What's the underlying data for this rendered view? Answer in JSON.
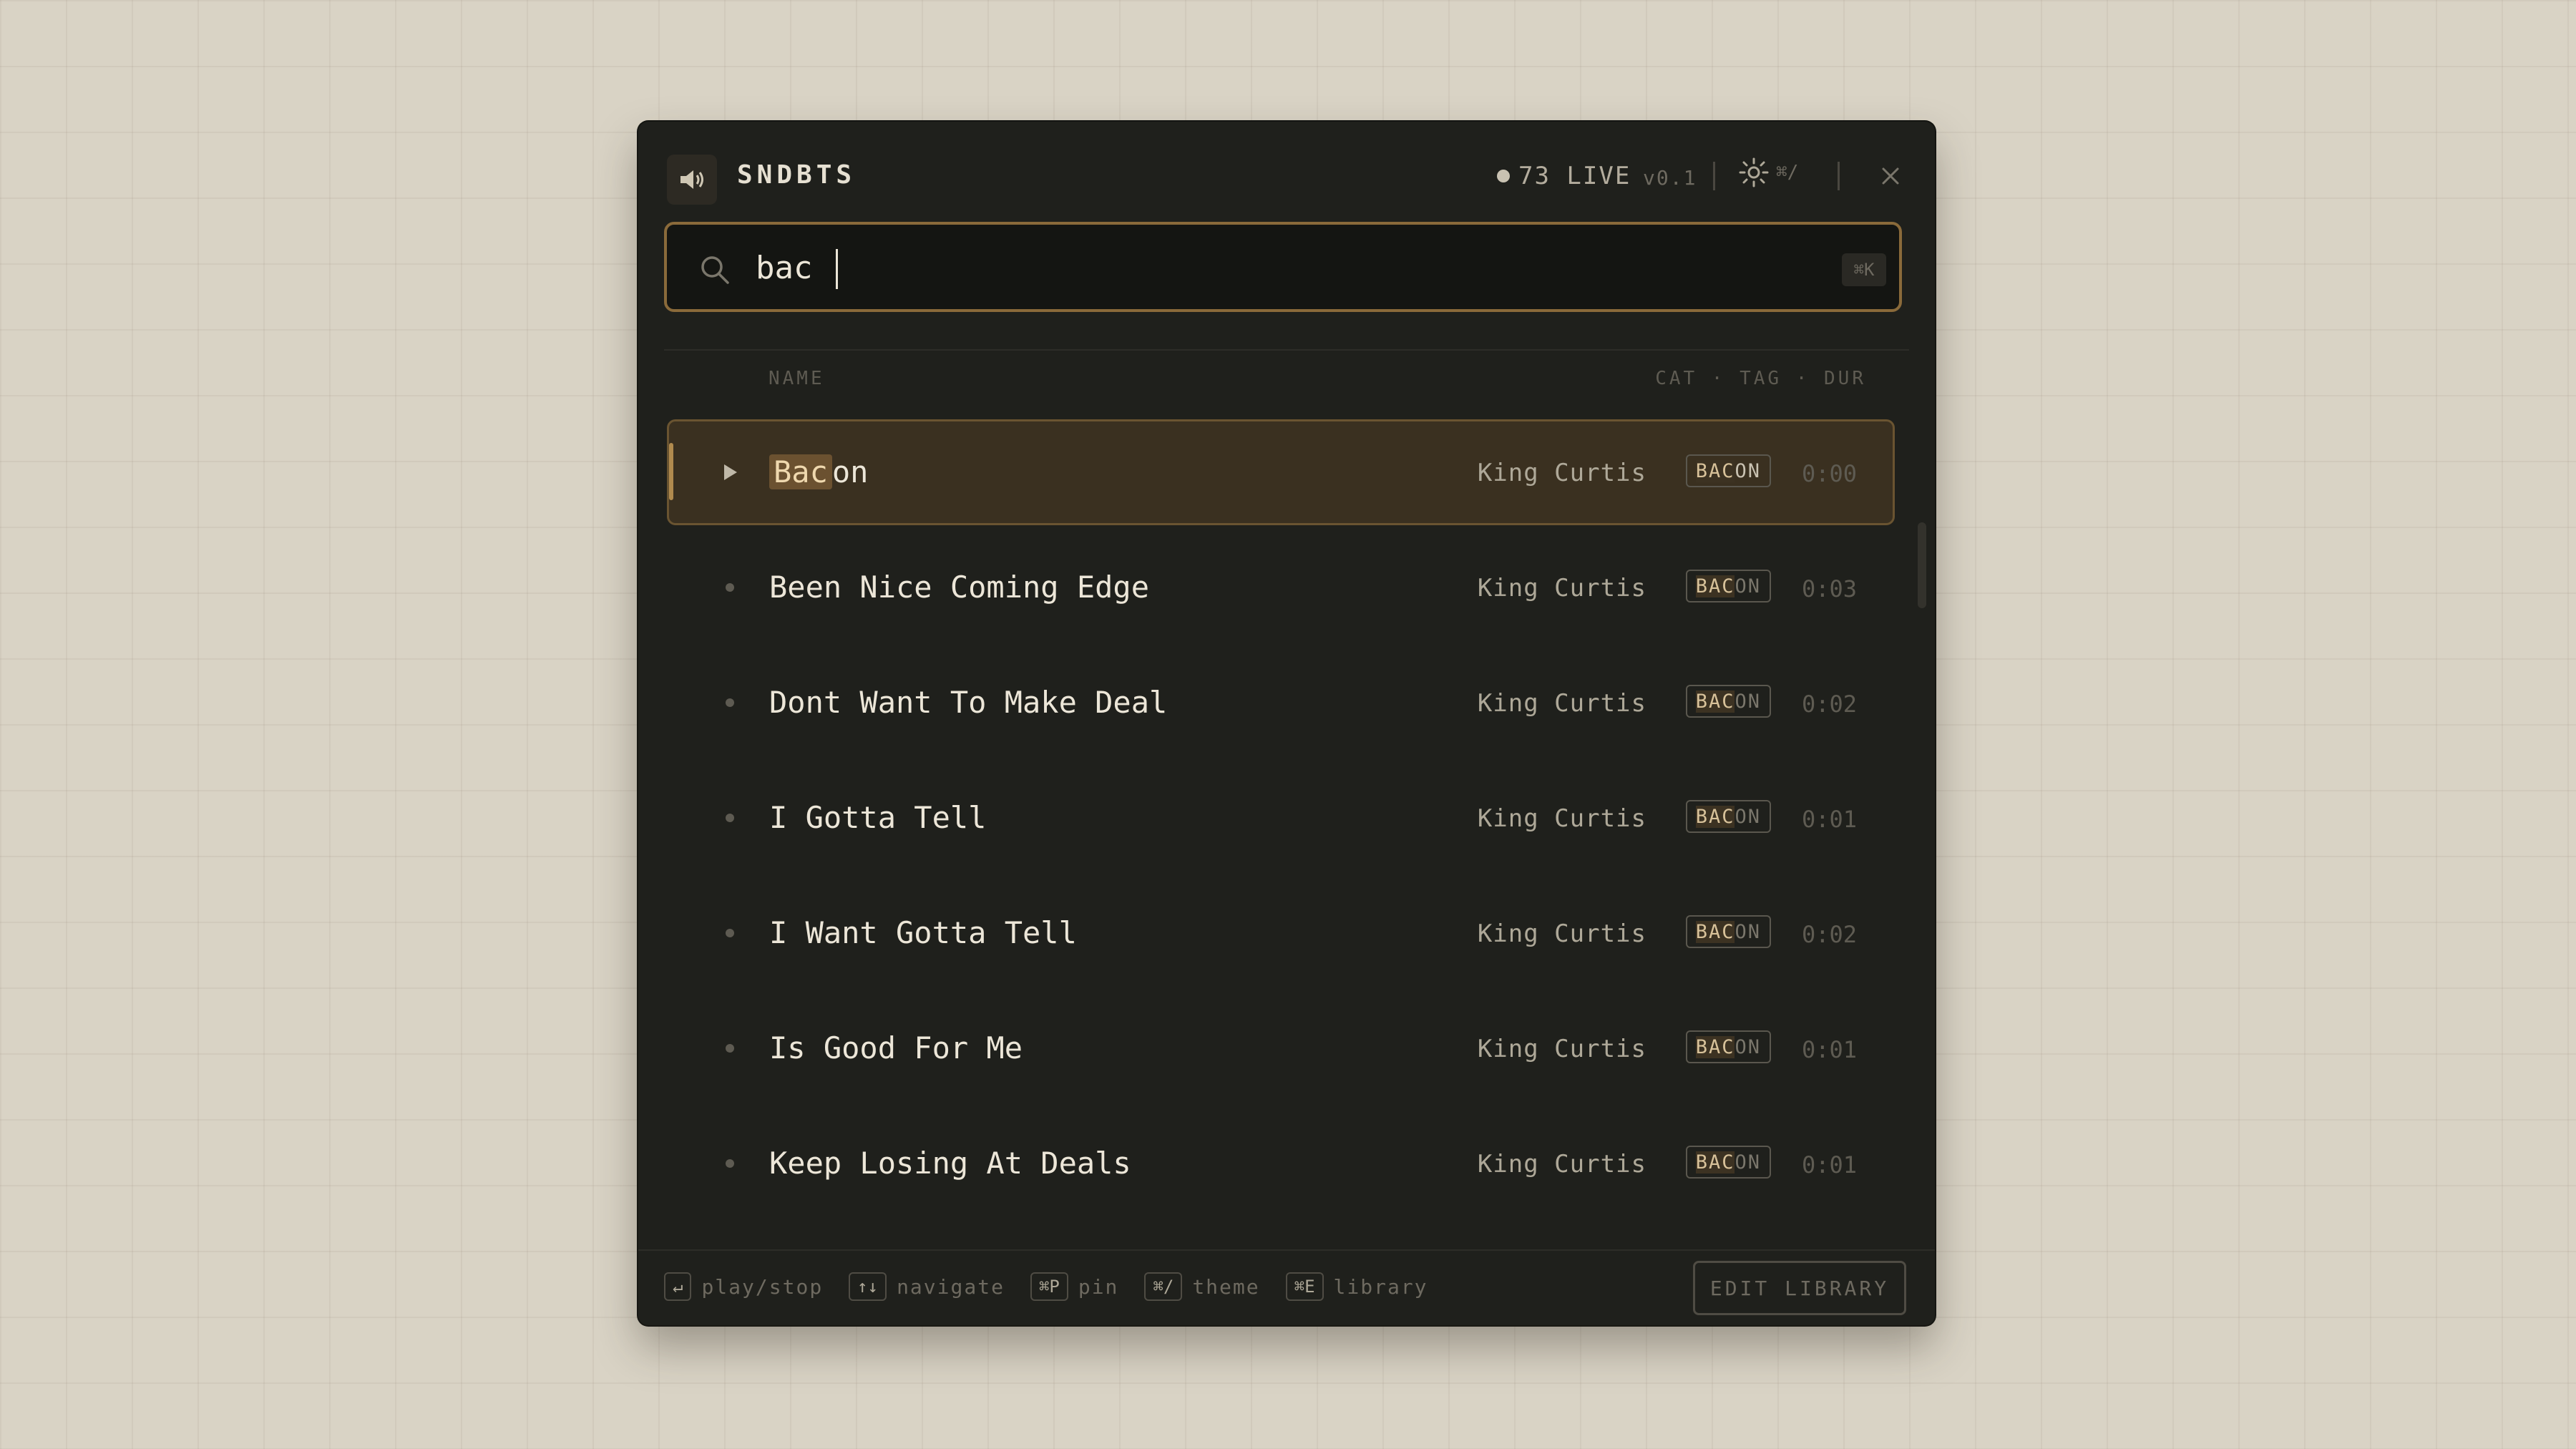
{
  "app": {
    "name": "SNDBTS",
    "live_count": "73 LIVE",
    "version": "v0.1",
    "theme_shortcut": "⌘/"
  },
  "search": {
    "value": "bac",
    "shortcut": "⌘K"
  },
  "columns": {
    "name": "NAME",
    "meta": "CAT · TAG · DUR"
  },
  "rows": [
    {
      "name_match": "Bac",
      "name_rest": "on",
      "artist": "King Curtis",
      "tag_match": "BAC",
      "tag_rest": "ON",
      "duration": "0:00"
    },
    {
      "name": "Been Nice Coming Edge",
      "artist": "King Curtis",
      "tag_match": "BAC",
      "tag_rest": "ON",
      "duration": "0:03"
    },
    {
      "name": "Dont Want To Make Deal",
      "artist": "King Curtis",
      "tag_match": "BAC",
      "tag_rest": "ON",
      "duration": "0:02"
    },
    {
      "name": "I Gotta Tell",
      "artist": "King Curtis",
      "tag_match": "BAC",
      "tag_rest": "ON",
      "duration": "0:01"
    },
    {
      "name": "I Want Gotta Tell",
      "artist": "King Curtis",
      "tag_match": "BAC",
      "tag_rest": "ON",
      "duration": "0:02"
    },
    {
      "name": "Is Good For Me",
      "artist": "King Curtis",
      "tag_match": "BAC",
      "tag_rest": "ON",
      "duration": "0:01"
    },
    {
      "name": "Keep Losing At Deals",
      "artist": "King Curtis",
      "tag_match": "BAC",
      "tag_rest": "ON",
      "duration": "0:01"
    }
  ],
  "footer": {
    "shortcuts": [
      {
        "key": "↵",
        "label": "play/stop"
      },
      {
        "key": "↑↓",
        "label": "navigate"
      },
      {
        "key": "⌘P",
        "label": "pin"
      },
      {
        "key": "⌘/",
        "label": "theme"
      },
      {
        "key": "⌘E",
        "label": "library"
      }
    ],
    "edit_label": "EDIT LIBRARY"
  },
  "icons": {
    "app": "speaker-icon",
    "search": "search-icon",
    "theme": "sun-icon",
    "close": "close-icon",
    "play": "play-icon"
  },
  "colors": {
    "accent": "#8a6a3a",
    "highlight": "#6b5130",
    "panel": "#1f201c",
    "background": "#d9d3c5"
  }
}
